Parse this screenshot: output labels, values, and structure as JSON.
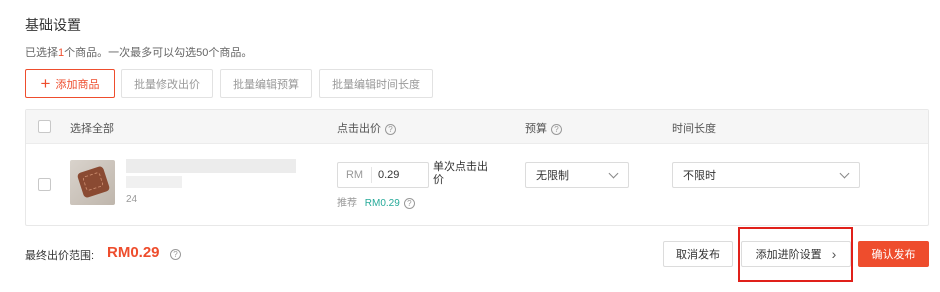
{
  "header": {
    "title": "基础设置",
    "subtitle_prefix": "已选择",
    "subtitle_count": "1",
    "subtitle_suffix": "个商品。一次最多可以勾选50个商品。"
  },
  "toolbar": {
    "add_label": "添加商品",
    "batch_price_label": "批量修改出价",
    "batch_budget_label": "批量编辑预算",
    "batch_duration_label": "批量编辑时间长度"
  },
  "table": {
    "col_select_all": "选择全部",
    "col_bid": "点击出价",
    "col_budget": "预算",
    "col_duration": "时间长度",
    "row": {
      "product_meta": "24",
      "currency_prefix": "RM",
      "bid_value": "0.29",
      "bid_unit": "单次点击出价",
      "recommend_label": "推荐",
      "recommend_value": "RM0.29",
      "budget_value": "无限制",
      "duration_value": "不限时"
    }
  },
  "footer": {
    "range_label": "最终出价范围:",
    "range_value": "RM0.29",
    "cancel_label": "取消发布",
    "advanced_label": "添加进阶设置",
    "confirm_label": "确认发布"
  },
  "colors": {
    "accent": "#ee4d2d",
    "recommend": "#26aa99",
    "highlight_box": "#e0201a"
  },
  "icons": [
    "plus-icon",
    "question-icon",
    "chevron-down-icon",
    "chevron-right-icon"
  ]
}
